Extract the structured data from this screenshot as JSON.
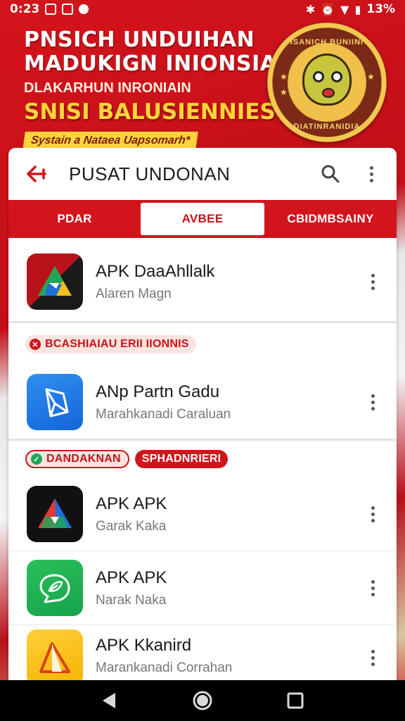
{
  "status_bar": {
    "time": "0:23",
    "battery": "13%"
  },
  "banner": {
    "line1": "PNSICH UNDUIHAN",
    "line2": "MADUKIGN INIONSIA",
    "line3": "DLAKARHUN INRONIAIN",
    "line4": "SNISI BALUSIENNIES",
    "pill": "Systain a Nataea Uapsomarh*",
    "badge_top": "ISANICH BUNIINI",
    "badge_bottom": "DIATINRANIDIA"
  },
  "topbar": {
    "title": "PUSAT UNDONAN"
  },
  "tabs": [
    {
      "label": "PDAR",
      "active": false
    },
    {
      "label": "AVBEE",
      "active": true
    },
    {
      "label": "CBIDMBSAINY",
      "active": false
    }
  ],
  "apps": [
    {
      "name": "APK DaaAhllalk",
      "subtitle": "Alaren Magn",
      "icon": "triangle-logo-icon"
    },
    {
      "name": "ANp Partn Gadu",
      "subtitle": "Marahkanadi Caraluan",
      "icon": "folded-paper-icon"
    },
    {
      "name": "APK APK",
      "subtitle": "Garak Kaka",
      "icon": "triangle-logo-icon"
    },
    {
      "name": "APK APK",
      "subtitle": "Narak Naka",
      "icon": "chat-leaf-icon"
    },
    {
      "name": "APK Kkanird",
      "subtitle": "Marankanadi Corrahan",
      "icon": "tent-icon"
    }
  ],
  "section1": {
    "tag": "BCASHIAIAU ERII IIONNIS"
  },
  "section2": {
    "tag1": "DANDAKNAN",
    "tag2": "SPHADNRIERI"
  },
  "colors": {
    "brand_red": "#d2141c",
    "accent_yellow": "#ffd43b",
    "text_dark": "#1a1a1a",
    "text_muted": "#777777"
  }
}
